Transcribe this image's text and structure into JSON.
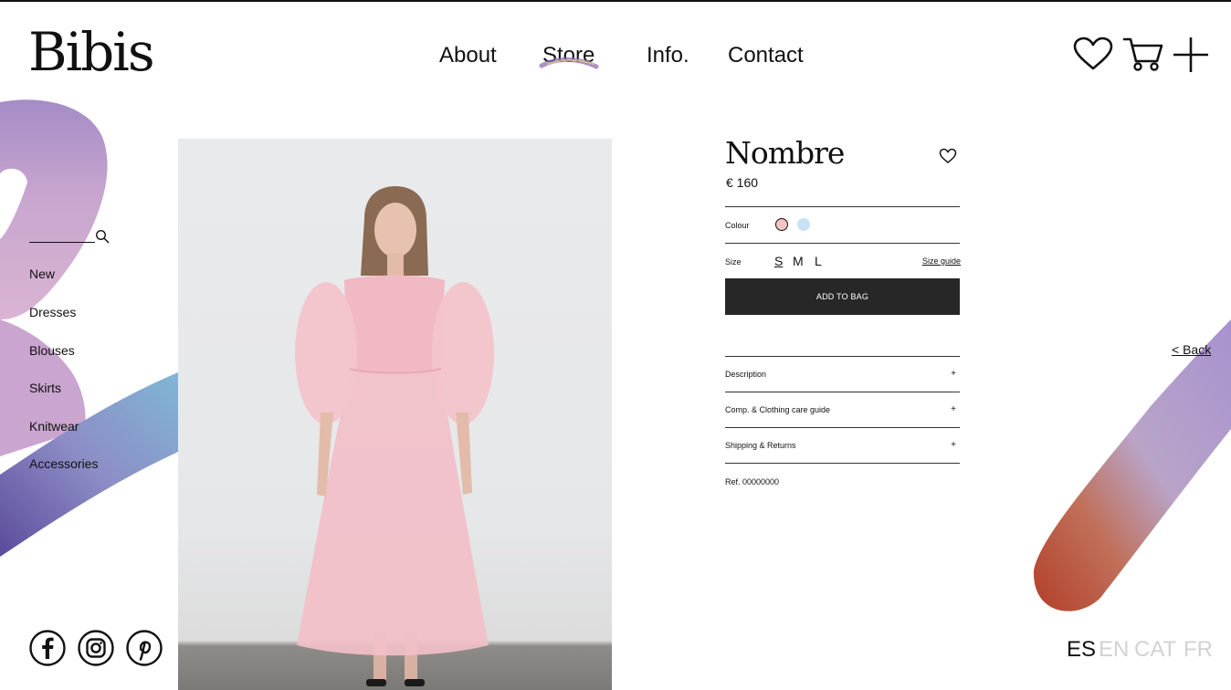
{
  "header": {
    "logo": "Bibis",
    "nav": [
      {
        "label": "About"
      },
      {
        "label": "Store"
      },
      {
        "label": "Info."
      },
      {
        "label": "Contact"
      }
    ],
    "icons": [
      "heart-icon",
      "cart-icon",
      "plus-icon"
    ]
  },
  "sidebar": {
    "search_placeholder": "",
    "categories": [
      {
        "label": "New"
      },
      {
        "label": "Dresses"
      },
      {
        "label": "Blouses"
      },
      {
        "label": "Skirts"
      },
      {
        "label": "Knitwear"
      },
      {
        "label": "Accessories"
      }
    ],
    "social": [
      "facebook-icon",
      "instagram-icon",
      "pinterest-icon"
    ]
  },
  "product": {
    "title": "Nombre",
    "price": "€ 160",
    "colour_label": "Colour",
    "colours": [
      {
        "name": "pink",
        "hex": "#f2c4c4",
        "selected": true
      },
      {
        "name": "light-blue",
        "hex": "#c9e0f6",
        "selected": false
      }
    ],
    "size_label": "Size",
    "sizes": [
      {
        "label": "S",
        "selected": true
      },
      {
        "label": "M",
        "selected": false
      },
      {
        "label": "L",
        "selected": false
      }
    ],
    "size_guide": "Size guide",
    "add_to_bag": "ADD TO BAG",
    "accordion": [
      {
        "label": "Description",
        "icon": "+"
      },
      {
        "label": "Comp. & Clothing care guide",
        "icon": "+"
      },
      {
        "label": "Shipping & Returns",
        "icon": "+"
      }
    ],
    "ref": "Ref. 00000000"
  },
  "back_link": "< Back",
  "languages": [
    {
      "label": "ES",
      "active": true
    },
    {
      "label": "EN",
      "active": false
    },
    {
      "label": "CAT",
      "active": false
    },
    {
      "label": "FR",
      "active": false
    }
  ],
  "colors": {
    "text": "#111111",
    "button_bg": "#272727",
    "inactive_lang": "#cfcfcf",
    "accent_purple": "#a98fc4",
    "accent_blue": "#7db3d2",
    "accent_rust": "#b5472c"
  }
}
